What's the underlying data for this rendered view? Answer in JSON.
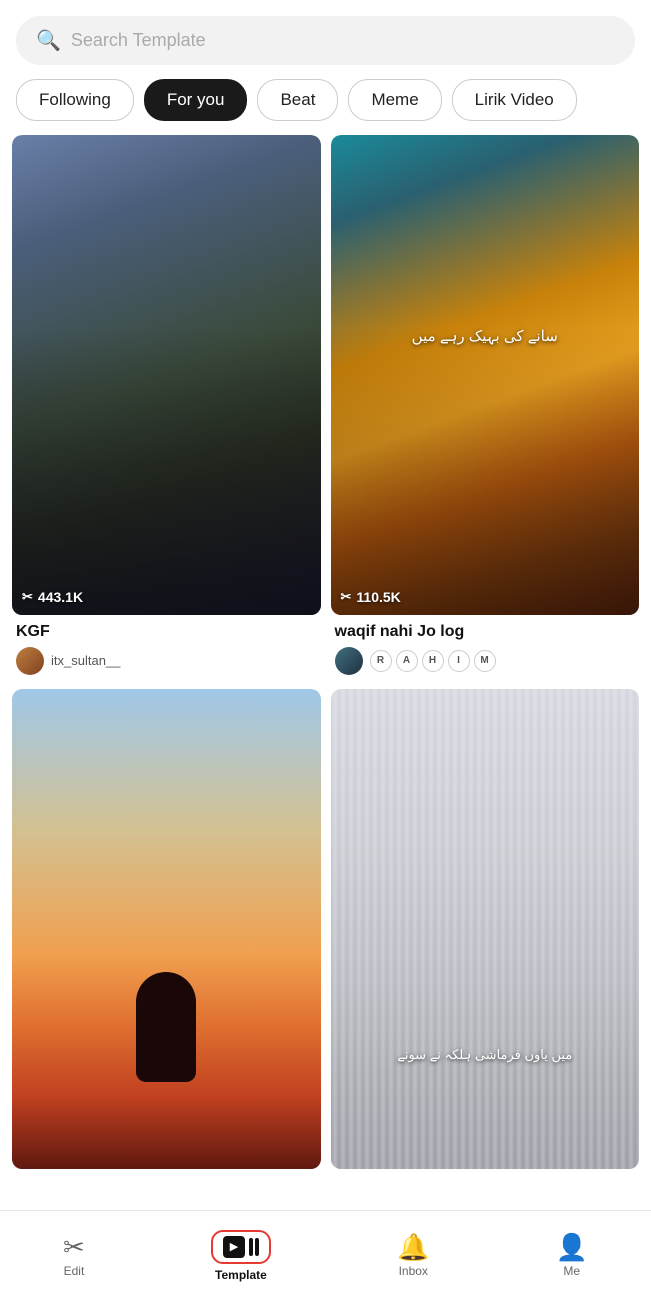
{
  "search": {
    "placeholder": "Search Template"
  },
  "tabs": [
    {
      "id": "following",
      "label": "Following",
      "active": false
    },
    {
      "id": "for-you",
      "label": "For you",
      "active": true
    },
    {
      "id": "beat",
      "label": "Beat",
      "active": false
    },
    {
      "id": "meme",
      "label": "Meme",
      "active": false
    },
    {
      "id": "lirik-video",
      "label": "Lirik Video",
      "active": false
    }
  ],
  "videos": [
    {
      "id": "kgf",
      "title": "KGF",
      "stats": "443.1K",
      "author": "itx_sultan__",
      "arabic_text": null,
      "thumb_type": "kgf"
    },
    {
      "id": "waqif",
      "title": "waqif nahi Jo log",
      "stats": "110.5K",
      "author_tags": [
        "R",
        "A",
        "H",
        "I",
        "M"
      ],
      "arabic_text": "سانے کی بہیک رہے میں",
      "thumb_type": "waqif"
    },
    {
      "id": "silhouette",
      "title": "",
      "stats": "",
      "author": "",
      "thumb_type": "silhouette"
    },
    {
      "id": "girl-mirror",
      "title": "",
      "stats": "",
      "arabic_text": "میں یاوں فرماشی ہلکہ نے سونے",
      "thumb_type": "girl"
    }
  ],
  "nav": {
    "items": [
      {
        "id": "edit",
        "label": "Edit",
        "icon": "scissors"
      },
      {
        "id": "template",
        "label": "Template",
        "icon": "template",
        "active": true
      },
      {
        "id": "inbox",
        "label": "Inbox",
        "icon": "bell"
      },
      {
        "id": "me",
        "label": "Me",
        "icon": "person"
      }
    ]
  }
}
